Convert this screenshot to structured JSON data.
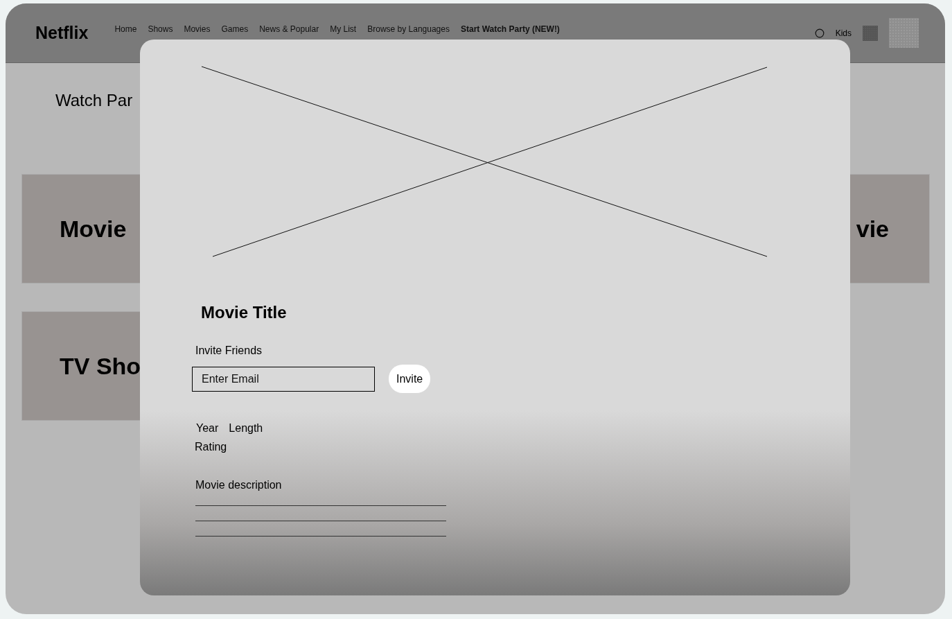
{
  "header": {
    "logo": "Netflix",
    "nav": [
      {
        "label": "Home",
        "highlighted": false
      },
      {
        "label": "Shows",
        "highlighted": false
      },
      {
        "label": "Movies",
        "highlighted": false
      },
      {
        "label": "Games",
        "highlighted": false
      },
      {
        "label": "News & Popular",
        "highlighted": false
      },
      {
        "label": "My List",
        "highlighted": false
      },
      {
        "label": "Browse by Languages",
        "highlighted": false
      },
      {
        "label": "Start Watch Party (NEW!)",
        "highlighted": true
      }
    ],
    "kids": "Kids"
  },
  "page": {
    "heading": "Watch Par",
    "rows": [
      {
        "left": "Movie",
        "right": "vie"
      },
      {
        "left": "TV Sho",
        "right": ""
      }
    ]
  },
  "modal": {
    "title": "Movie Title",
    "invite_label": "Invite Friends",
    "email_placeholder": "Enter Email",
    "invite_button": "Invite",
    "meta": [
      "Year",
      "Length"
    ],
    "rating": "Rating",
    "description": "Movie description"
  }
}
